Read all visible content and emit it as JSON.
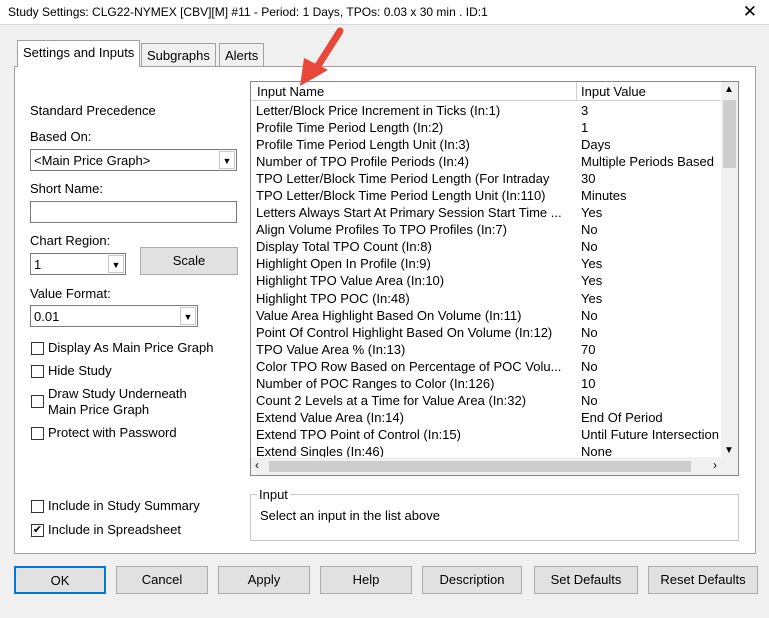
{
  "window": {
    "title": "Study Settings: CLG22-NYMEX [CBV][M]  #11 - Period: 1 Days, TPOs: 0.03 x 30 min  . ID:1",
    "close_glyph": "✕"
  },
  "tabs": [
    {
      "label": "Settings and Inputs",
      "active": true
    },
    {
      "label": "Subgraphs",
      "active": false
    },
    {
      "label": "Alerts",
      "active": false
    }
  ],
  "left": {
    "standard_precedence": "Standard Precedence",
    "based_on_label": "Based On:",
    "based_on_value": "<Main Price Graph>",
    "short_name_label": "Short Name:",
    "short_name_value": "",
    "chart_region_label": "Chart Region:",
    "chart_region_value": "1",
    "scale_button": "Scale",
    "value_format_label": "Value Format:",
    "value_format_value": "0.01",
    "checkboxes": [
      {
        "label": "Display As Main Price Graph",
        "checked": false
      },
      {
        "label": "Hide Study",
        "checked": false
      },
      {
        "label": "Draw Study Underneath",
        "label2": "Main Price Graph",
        "checked": false
      },
      {
        "label": "Protect with Password",
        "checked": false
      }
    ],
    "include_summary": {
      "label": "Include in Study Summary",
      "checked": false
    },
    "include_spreadsheet": {
      "label": "Include in Spreadsheet",
      "checked": true
    }
  },
  "grid": {
    "columns": [
      "Input Name",
      "Input Value"
    ],
    "rows": [
      [
        "Letter/Block Price Increment in Ticks   (In:1)",
        "3"
      ],
      [
        "Profile Time Period Length   (In:2)",
        "1"
      ],
      [
        "Profile Time Period Length Unit   (In:3)",
        "Days"
      ],
      [
        "Number of TPO Profile Periods   (In:4)",
        "Multiple Periods Based"
      ],
      [
        "TPO Letter/Block Time Period Length (For Intraday",
        "30"
      ],
      [
        "TPO Letter/Block Time Period Length Unit   (In:110)",
        "Minutes"
      ],
      [
        "Letters Always Start At Primary Session Start Time   ...",
        "Yes"
      ],
      [
        "Align Volume Profiles To TPO Profiles   (In:7)",
        "No"
      ],
      [
        "Display Total TPO Count   (In:8)",
        "No"
      ],
      [
        "Highlight Open In Profile   (In:9)",
        "Yes"
      ],
      [
        "Highlight TPO Value Area   (In:10)",
        "Yes"
      ],
      [
        "Highlight TPO POC   (In:48)",
        "Yes"
      ],
      [
        "Value Area Highlight Based On Volume   (In:11)",
        "No"
      ],
      [
        "Point Of Control Highlight Based On Volume   (In:12)",
        "No"
      ],
      [
        "TPO Value Area %   (In:13)",
        "70"
      ],
      [
        "Color TPO Row Based on Percentage of POC Volu...",
        "No"
      ],
      [
        "Number of POC Ranges to Color   (In:126)",
        "10"
      ],
      [
        "Count 2 Levels at a Time for Value Area   (In:32)",
        "No"
      ],
      [
        "Extend Value Area   (In:14)",
        "End Of Period"
      ],
      [
        "Extend TPO Point of Control   (In:15)",
        "Until Future Intersection"
      ],
      [
        "Extend Singles   (In:46)",
        "None"
      ]
    ]
  },
  "input_box": {
    "legend": "Input",
    "text": "Select an input in the list above"
  },
  "buttons": [
    "OK",
    "Cancel",
    "Apply",
    "Help",
    "Description",
    "Set Defaults",
    "Reset Defaults"
  ],
  "colors": {
    "annotation_arrow": "#e8473a",
    "window_bg": "#f0f0f0",
    "panel_bg": "#ffffff"
  }
}
